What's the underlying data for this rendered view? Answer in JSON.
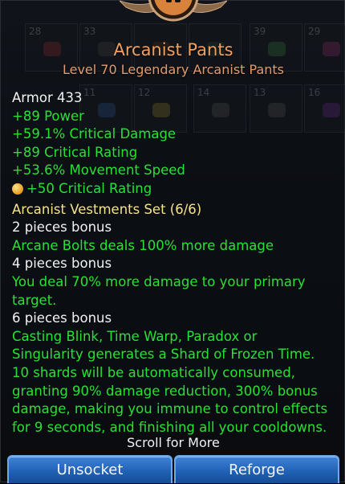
{
  "inventory_slots": [
    {
      "num": "28",
      "gem": "#7a2a2a"
    },
    {
      "num": "33",
      "gem": "#3a3a3a"
    },
    {
      "num": "",
      "gem": "#4a2f1a"
    },
    {
      "num": "",
      "gem": "#2a3f2a"
    },
    {
      "num": "39",
      "gem": "#2f6a3a"
    },
    {
      "num": "29",
      "gem": "#7a2a5a"
    },
    {
      "num": "11",
      "gem": "#2a4a7a"
    },
    {
      "num": "12",
      "gem": "#7a6a2a"
    },
    {
      "num": "14",
      "gem": "#4a4a4a"
    },
    {
      "num": "13",
      "gem": "#4a4a4a"
    },
    {
      "num": "16",
      "gem": "#5a2a7a"
    }
  ],
  "item": {
    "name": "Arcanist Pants",
    "subtitle": "Level 70 Legendary Arcanist Pants"
  },
  "stats": {
    "armor": "Armor 433",
    "power": "+89 Power",
    "crit_damage": "+59.1% Critical Damage",
    "crit_rating": "+89 Critical Rating",
    "move_speed": "+53.6% Movement Speed",
    "gem_bonus": "+50 Critical Rating",
    "gem_icon": "orange-gem-icon"
  },
  "set": {
    "name": "Arcanist Vestments Set (6/6)",
    "bonus2_label": "2 pieces bonus",
    "bonus2_text": "Arcane Bolts deals 100% more damage",
    "bonus4_label": "4 pieces bonus",
    "bonus4_line1": "You deal 70% more damage to your primary",
    "bonus4_line2": "target.",
    "bonus6_label": "6 pieces bonus",
    "bonus6_line1": "Casting Blink, Time Warp, Paradox or",
    "bonus6_line2": "Singularity generates a Shard of Frozen Time.",
    "bonus6_line3": "10 shards will be automatically consumed,",
    "bonus6_line4": "granting 90% damage reduction, 300% bonus",
    "bonus6_line5": "damage, making you immune to control effects",
    "bonus6_line6": "for 9 seconds, and finishing all your cooldowns."
  },
  "footer": {
    "scroll_hint": "Scroll for More",
    "unsocket_label": "Unsocket",
    "reforge_label": "Reforge"
  },
  "colors": {
    "title": "#f0a060",
    "stat_green": "#27e234",
    "set_yellow": "#f5e38a",
    "button_blue": "#2f6fc4"
  }
}
